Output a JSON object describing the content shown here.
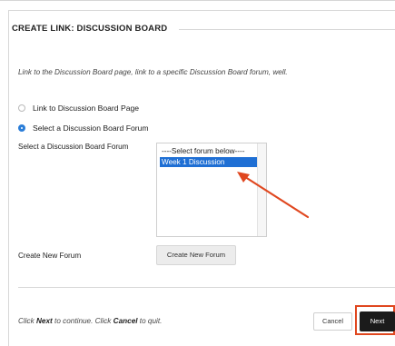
{
  "section": {
    "title": "CREATE LINK: DISCUSSION BOARD"
  },
  "instructions": "Link to the Discussion Board page, link to a specific Discussion Board forum, well.",
  "options": {
    "link_page": {
      "label": "Link to Discussion Board Page",
      "checked": false
    },
    "select_forum": {
      "label": "Select a Discussion Board Forum",
      "checked": true
    }
  },
  "forum_select": {
    "label": "Select a Discussion Board Forum",
    "placeholder": "----Select forum below----",
    "selected_option": "Week 1 Discussion"
  },
  "create_forum": {
    "label": "Create New Forum",
    "button_label": "Create New Forum"
  },
  "footer": {
    "text_prefix": "Click ",
    "next_word": "Next",
    "text_middle": " to continue. Click ",
    "cancel_word": "Cancel",
    "text_suffix": " to quit.",
    "cancel_button": "Cancel",
    "next_button": "Next"
  },
  "colors": {
    "accent_blue": "#1f6fd4",
    "annotation_red": "#e0471f",
    "next_button_bg": "#1b1b1b"
  }
}
